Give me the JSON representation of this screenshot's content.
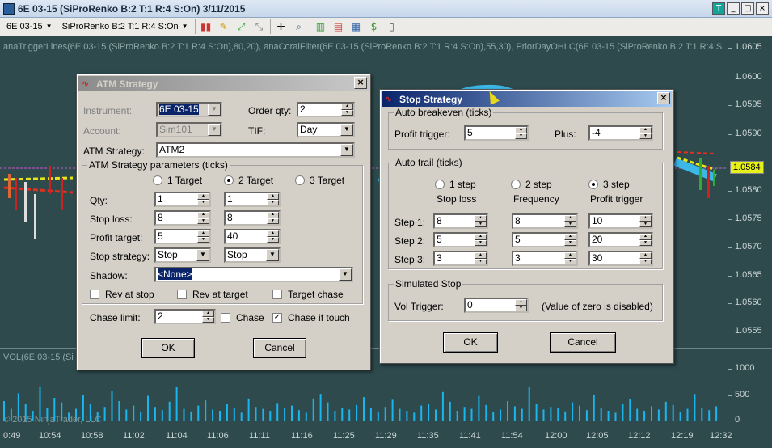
{
  "window": {
    "title": "6E 03-15 (SiProRenko B:2 T:1 R:4 S:On)  3/11/2015",
    "controls": [
      "T",
      "_",
      "□",
      "×"
    ]
  },
  "toolbar": {
    "instrument": "6E 03-15",
    "bar_type": "SiProRenko B:2 T:1 R:4 S:On"
  },
  "chart": {
    "indicators_label": "anaTriggerLines(6E 03-15 (SiProRenko B:2 T:1 R:4 S:On),80,20), anaCoralFilter(6E 03-15 (SiProRenko B:2 T:1 R:4 S:On),55,30), PriorDayOHLC(6E 03-15 (SiProRenko B:2 T:1 R:4 S",
    "price_ticks": [
      "1.0605",
      "1.0600",
      "1.0595",
      "1.0590",
      "1.0580",
      "1.0575",
      "1.0570",
      "1.0565",
      "1.0560",
      "1.0555"
    ],
    "current_price": "1.0584",
    "volume_label": "VOL(6E 03-15 (Si",
    "volume_ticks": [
      "1000",
      "500",
      "0"
    ],
    "time_ticks": [
      "0:49",
      "10:54",
      "10:58",
      "11:02",
      "11:04",
      "11:06",
      "11:11",
      "11:16",
      "11:25",
      "11:29",
      "11:35",
      "11:41",
      "11:54",
      "12:00",
      "12:05",
      "12:12",
      "12:19",
      "12:32"
    ],
    "copyright": "© 2015 NinjaTrader, LLC",
    "volumes": [
      300,
      180,
      420,
      250,
      150,
      520,
      200,
      350,
      280,
      120,
      180,
      390,
      260,
      130,
      210,
      450,
      300,
      170,
      230,
      140,
      380,
      210,
      160,
      290,
      520,
      180,
      140,
      230,
      310,
      170,
      150,
      260,
      190,
      120,
      340,
      210,
      180,
      150,
      270,
      190,
      230,
      160,
      120,
      340,
      410,
      280,
      150,
      200,
      170,
      240,
      360,
      190,
      140,
      210,
      320,
      180,
      150,
      120,
      230,
      260,
      170,
      440,
      290,
      150,
      210,
      180,
      380,
      240,
      130,
      170,
      300,
      220,
      180,
      520,
      260,
      170,
      210,
      190,
      140,
      280,
      230,
      160,
      400,
      200,
      150,
      120,
      260,
      330,
      180,
      150,
      220,
      170,
      290,
      240,
      130,
      180,
      410,
      200,
      160,
      220
    ]
  },
  "atm_dialog": {
    "title": "ATM Strategy",
    "instrument_label": "Instrument:",
    "instrument_value": "6E 03-15",
    "account_label": "Account:",
    "account_value": "Sim101",
    "order_qty_label": "Order qty:",
    "order_qty_value": "2",
    "tif_label": "TIF:",
    "tif_value": "Day",
    "atm_strategy_label": "ATM Strategy:",
    "atm_strategy_value": "ATM2",
    "params_group": "ATM Strategy parameters (ticks)",
    "target_radios": [
      "1 Target",
      "2 Target",
      "3 Target"
    ],
    "qty_label": "Qty:",
    "qty_values": [
      "1",
      "1"
    ],
    "stop_loss_label": "Stop loss:",
    "stop_loss_values": [
      "8",
      "8"
    ],
    "profit_target_label": "Profit target:",
    "profit_target_values": [
      "5",
      "40"
    ],
    "stop_strategy_label": "Stop strategy:",
    "stop_strategy_values": [
      "Stop",
      "Stop"
    ],
    "shadow_label": "Shadow:",
    "shadow_value": "<None>",
    "rev_at_stop": "Rev at stop",
    "rev_at_target": "Rev at target",
    "target_chase": "Target chase",
    "chase_limit_label": "Chase limit:",
    "chase_limit_value": "2",
    "chase": "Chase",
    "chase_if_touch": "Chase if touch",
    "ok": "OK",
    "cancel": "Cancel"
  },
  "stop_dialog": {
    "title": "Stop Strategy",
    "auto_breakeven_group": "Auto breakeven (ticks)",
    "profit_trigger_label": "Profit trigger:",
    "profit_trigger_value": "5",
    "plus_label": "Plus:",
    "plus_value": "-4",
    "auto_trail_group": "Auto trail (ticks)",
    "step_radios": [
      "1 step",
      "2 step",
      "3 step"
    ],
    "col_headers": [
      "Stop loss",
      "Frequency",
      "Profit trigger"
    ],
    "step1_label": "Step 1:",
    "step1_values": [
      "8",
      "8",
      "10"
    ],
    "step2_label": "Step 2:",
    "step2_values": [
      "5",
      "5",
      "20"
    ],
    "step3_label": "Step 3:",
    "step3_values": [
      "3",
      "3",
      "30"
    ],
    "simulated_stop_group": "Simulated Stop",
    "vol_trigger_label": "Vol Trigger:",
    "vol_trigger_value": "0",
    "vol_trigger_note": "(Value of zero is disabled)",
    "ok": "OK",
    "cancel": "Cancel"
  }
}
